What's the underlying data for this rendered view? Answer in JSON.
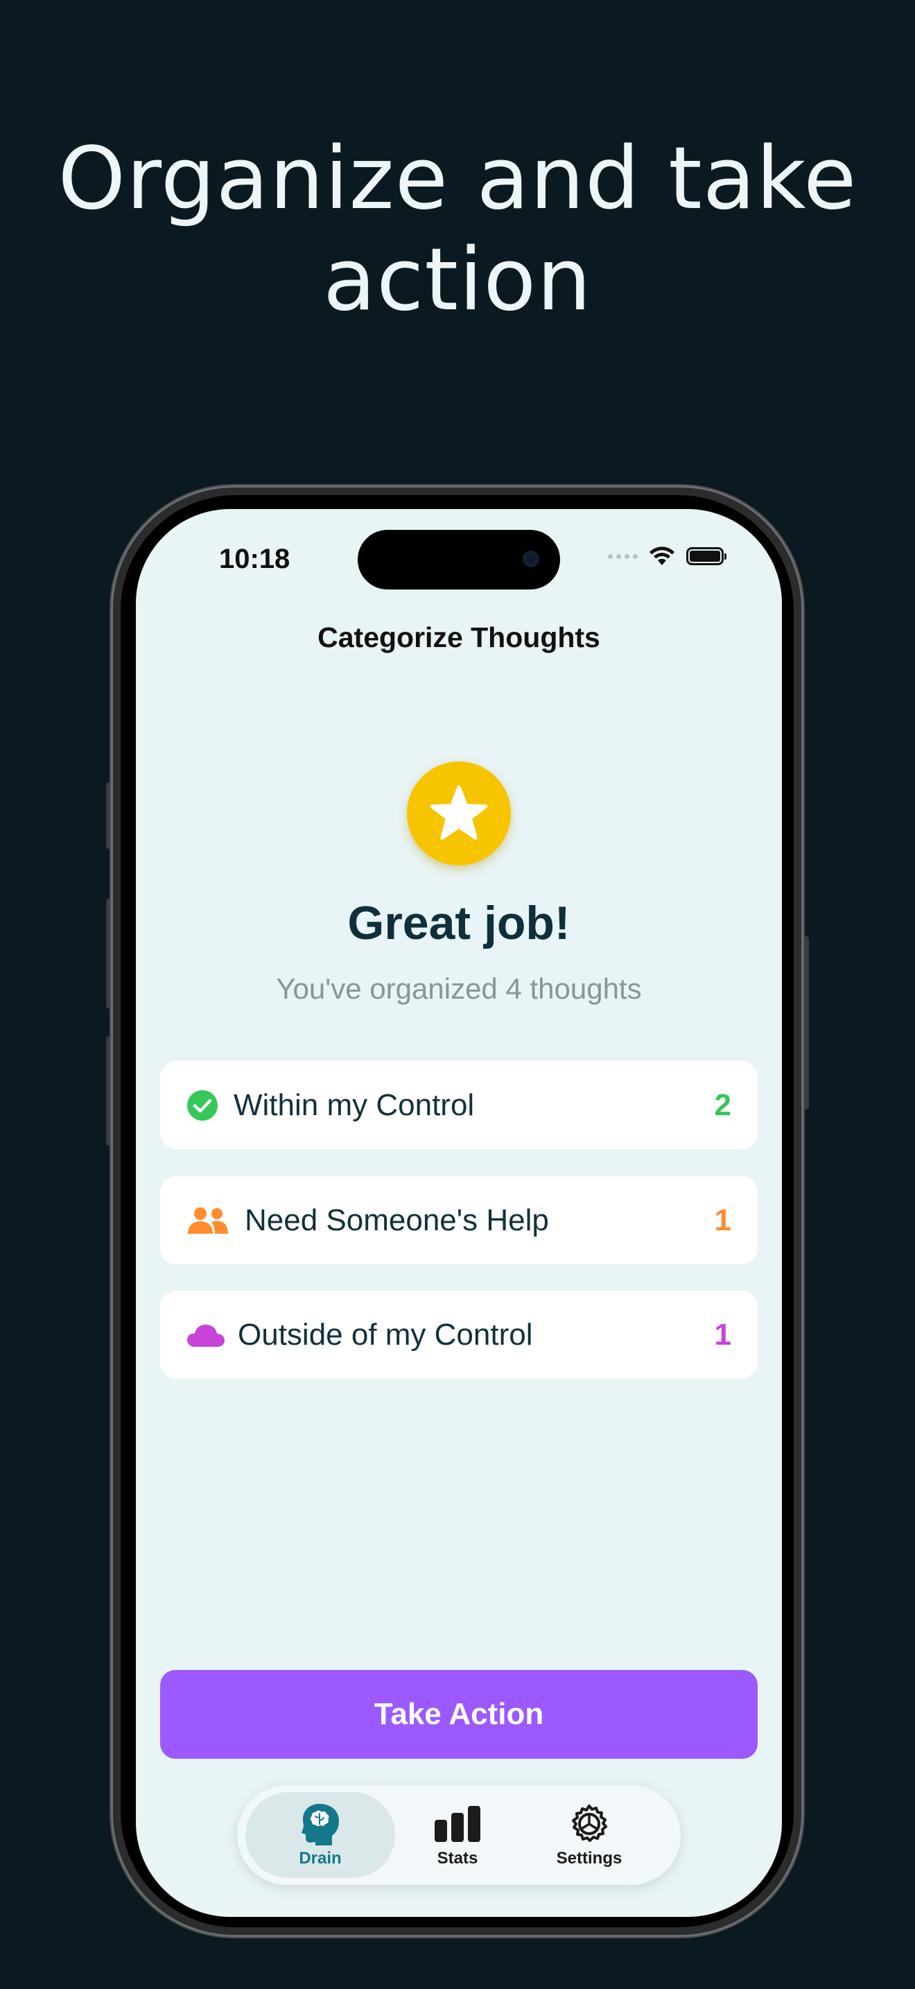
{
  "headline": {
    "line1": "Organize and take",
    "line2": "action"
  },
  "status_bar": {
    "time": "10:18"
  },
  "nav": {
    "title": "Categorize Thoughts"
  },
  "summary": {
    "badge_icon": "star-icon",
    "title": "Great job!",
    "subtitle": "You've organized 4 thoughts"
  },
  "categories": [
    {
      "label": "Within my Control",
      "count": "2",
      "icon": "checkmark-circle-icon",
      "color": "#34c759"
    },
    {
      "label": "Need Someone's Help",
      "count": "1",
      "icon": "people-icon",
      "color": "#ff8c2e"
    },
    {
      "label": "Outside of my Control",
      "count": "1",
      "icon": "cloud-icon",
      "color": "#c843d9"
    }
  ],
  "primary_action": {
    "label": "Take Action",
    "color": "#9b59ff"
  },
  "tabs": [
    {
      "label": "Drain",
      "icon": "brain-head-icon",
      "active": true
    },
    {
      "label": "Stats",
      "icon": "bar-chart-icon",
      "active": false
    },
    {
      "label": "Settings",
      "icon": "gear-icon",
      "active": false
    }
  ],
  "colors": {
    "background": "#0b1a21",
    "screen": "#e8f4f5",
    "accent_tab": "#13798a",
    "star": "#f7c500"
  }
}
